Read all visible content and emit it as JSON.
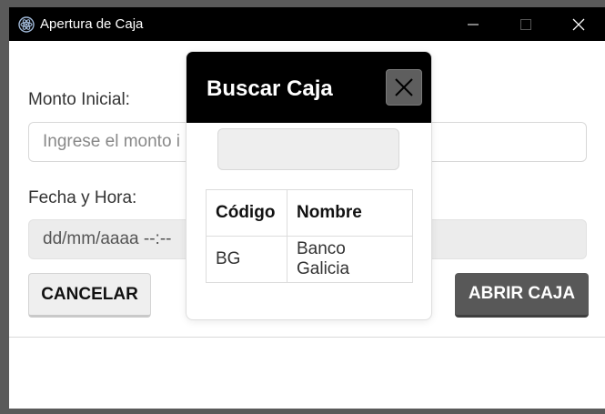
{
  "window": {
    "title": "Apertura de Caja",
    "controls": {
      "minimize": "minimize-icon",
      "maximize": "maximize-icon",
      "close": "close-icon"
    }
  },
  "form": {
    "monto_label": "Monto Inicial:",
    "monto_placeholder": "Ingrese el monto i",
    "fecha_label": "Fecha y Hora:",
    "fecha_value": "dd/mm/aaaa --:--",
    "cancel_label": "CANCELAR",
    "open_label": "ABRIR CAJA"
  },
  "modal": {
    "title": "Buscar Caja",
    "search_value": "",
    "columns": [
      "Código",
      "Nombre"
    ],
    "rows": [
      {
        "codigo": "BG",
        "nombre": "Banco Galicia"
      }
    ]
  },
  "colors": {
    "titlebar": "#000000",
    "accent_button": "#585858",
    "background": "#ffffff"
  }
}
